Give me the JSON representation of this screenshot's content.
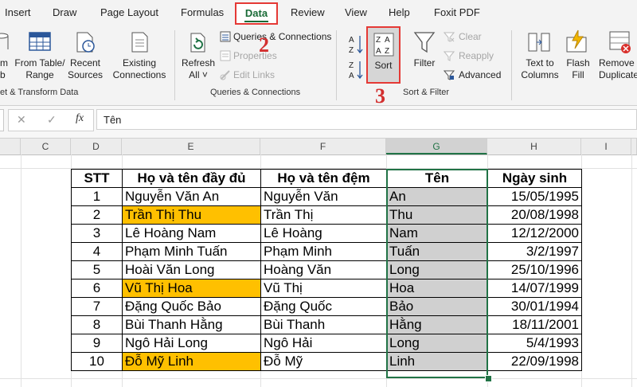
{
  "ribbon_tabs": [
    "Insert",
    "Draw",
    "Page Layout",
    "Formulas",
    "Data",
    "Review",
    "View",
    "Help",
    "Foxit PDF"
  ],
  "active_tab": "Data",
  "get_transform": {
    "partial_button": "m\nb",
    "from_table": "From Table/\nRange",
    "recent_sources": "Recent\nSources",
    "existing_connections": "Existing\nConnections",
    "group_label": "et & Transform Data"
  },
  "queries": {
    "refresh_all": "Refresh\nAll ˅",
    "queries_connections": "Queries & Connections",
    "properties": "Properties",
    "edit_links": "Edit Links",
    "group_label": "Queries & Connections"
  },
  "sort_filter": {
    "sort_az": "A→Z",
    "sort_za": "Z→A",
    "sort": "Sort",
    "filter": "Filter",
    "clear": "Clear",
    "reapply": "Reapply",
    "advanced": "Advanced",
    "group_label": "Sort & Filter"
  },
  "data_tools": {
    "text_to_columns": "Text to\nColumns",
    "flash_fill": "Flash\nFill",
    "remove_duplicates": "Remove\nDuplicate"
  },
  "annotations": [
    "2",
    "3"
  ],
  "formula_bar": {
    "cancel": "✕",
    "enter": "✓",
    "fx": "fx",
    "value": "Tên"
  },
  "columns": [
    "C",
    "D",
    "E",
    "F",
    "G",
    "H",
    "I"
  ],
  "selected_column": "G",
  "table": {
    "headers": [
      "STT",
      "Họ và tên đầy đủ",
      "Họ và tên đệm",
      "Tên",
      "Ngày sinh"
    ],
    "rows": [
      [
        "1",
        "Nguyễn Văn An",
        "Nguyễn Văn",
        "An",
        "15/05/1995"
      ],
      [
        "2",
        "Trần Thị Thu",
        "Trần Thị",
        "Thu",
        "20/08/1998"
      ],
      [
        "3",
        "Lê Hoàng Nam",
        "Lê Hoàng",
        "Nam",
        "12/12/2000"
      ],
      [
        "4",
        "Phạm Minh Tuấn",
        "Phạm Minh",
        "Tuấn",
        "3/2/1997"
      ],
      [
        "5",
        "Hoài Văn Long",
        "Hoàng Văn",
        "Long",
        "25/10/1996"
      ],
      [
        "6",
        "Vũ Thị Hoa",
        "Vũ Thị",
        "Hoa",
        "14/07/1999"
      ],
      [
        "7",
        "Đặng Quốc Bảo",
        "Đặng Quốc",
        "Bảo",
        "30/01/1994"
      ],
      [
        "8",
        "Bùi Thanh Hằng",
        "Bùi Thanh",
        "Hằng",
        "18/11/2001"
      ],
      [
        "9",
        "Ngô Hải Long",
        "Ngô Hải",
        "Long",
        "5/4/1993"
      ],
      [
        "10",
        "Đỗ Mỹ Linh",
        "Đỗ Mỹ",
        "Linh",
        "22/09/1998"
      ]
    ],
    "highlighted_rows": [
      1,
      5,
      9
    ],
    "highlight_color": "#ffc000",
    "selection_color": "#d0d0d0",
    "accent_color": "#217346"
  }
}
